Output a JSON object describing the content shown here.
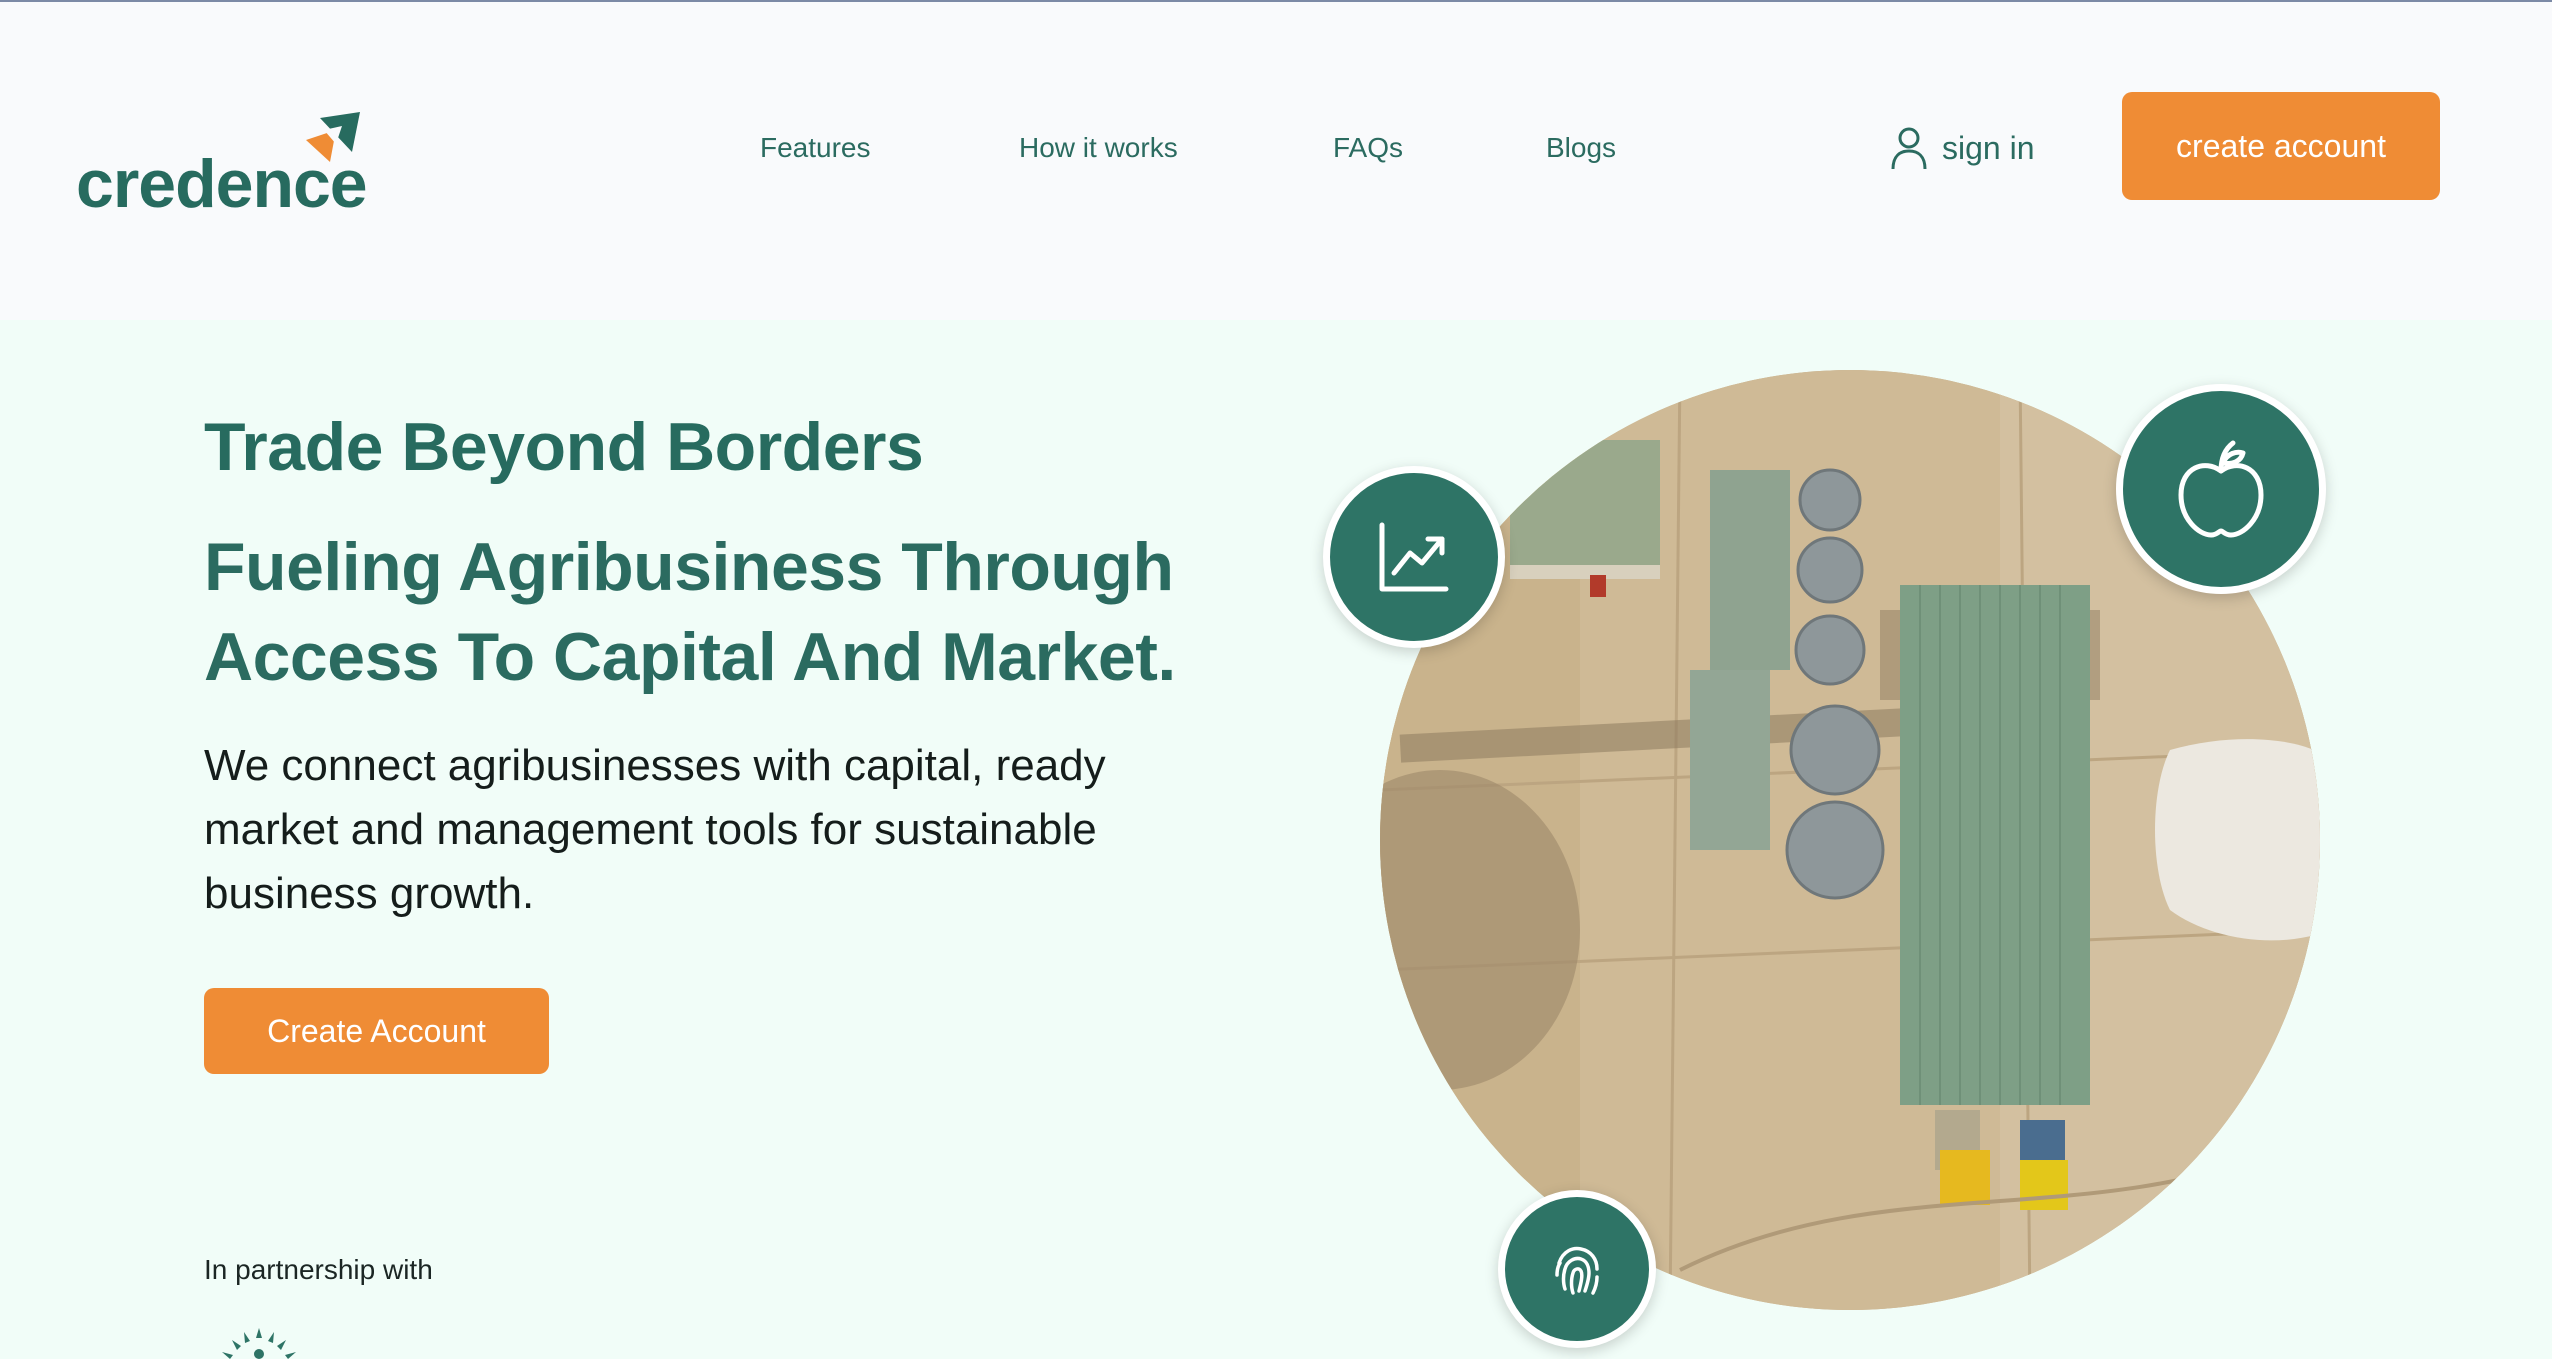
{
  "brand": {
    "name": "credence"
  },
  "nav": {
    "links": [
      "Features",
      "How it works",
      "FAQs",
      "Blogs"
    ],
    "signin_label": "sign in",
    "create_label": "create account"
  },
  "hero": {
    "tagline": "Trade Beyond Borders",
    "title": "Fueling Agribusiness Through Access To Capital And Market.",
    "body": "We connect agribusinesses with capital, ready market and management tools for sustainable business growth.",
    "cta_label": "Create Account",
    "partnership_label": "In partnership with"
  },
  "icons": {
    "chart": "chart-trend-icon",
    "apple": "apple-icon",
    "fingerprint": "fingerprint-icon",
    "user": "user-icon"
  },
  "colors": {
    "brand_green": "#276b5f",
    "accent_orange": "#ef8c35",
    "hero_bg": "#f1fdf8",
    "header_bg": "#f9fafc"
  }
}
